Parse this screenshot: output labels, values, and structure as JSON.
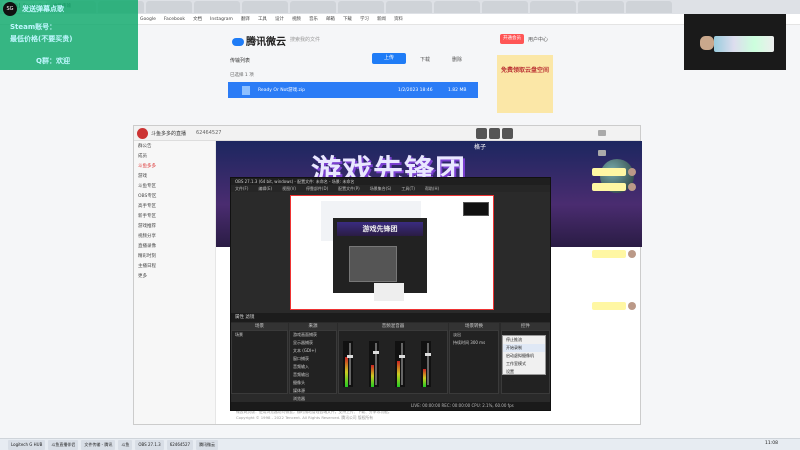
{
  "browser": {
    "tabs": [
      "【斗鱼】Ready Or Not",
      "文件传输",
      "",
      "",
      "",
      "",
      "",
      "",
      "",
      "",
      "",
      "",
      "",
      ""
    ],
    "bookmarks": [
      "Google",
      "Facebook",
      "文档",
      "Instagram",
      "翻译",
      "工具",
      "设计",
      "视频",
      "音乐",
      "邮箱",
      "下载",
      "学习",
      "新闻",
      "资料"
    ]
  },
  "overlay": {
    "logo": "SG",
    "line1": "发送弹幕点歌",
    "line2": "Steam账号：",
    "line3": "最低价格(不要买贵)",
    "line4": "Q群：欢迎"
  },
  "weiyun": {
    "logo": "腾讯微云",
    "search": "搜索我的文件",
    "member": "开通会员",
    "user": "用户中心",
    "task_title": "传输列表",
    "upload_btn": "上传",
    "download_btn": "下载",
    "delete_btn": "删除",
    "select_all": "已选择 1 项",
    "file_name": "Ready Or Not游戏.zip",
    "file_time": "1/2/2023 18:46",
    "file_size": "1.82 MB",
    "ad_text": "免费领取云盘空间"
  },
  "qq": {
    "title": "斗鱼多多的直播",
    "ratio": "62464527",
    "banner_label": "格子",
    "banner_title": "游戏先锋团",
    "side_items": [
      "群公告",
      "成员",
      "斗鱼多多",
      "游戏",
      "斗鱼专区",
      "OBS专区",
      "高手专区",
      "新手专区",
      "游戏推荐",
      "视频分享",
      "直播录像",
      "精彩时刻",
      "主播日程",
      "更多"
    ]
  },
  "obs": {
    "title": "OBS 27.1.3 (64 bit, windows) - 配置文件: 未命名 - 场景: 未命名",
    "menu": [
      "文件(F)",
      "编辑(E)",
      "视图(V)",
      "停靠部件(D)",
      "配置文件(P)",
      "场景集合(S)",
      "工具(T)",
      "帮助(H)"
    ],
    "preview_banner": "游戏先锋团",
    "ctl_bar": "属性  滤镜",
    "panels": [
      "场景",
      "来源",
      "音频混音器",
      "场景转换",
      "控件"
    ],
    "scene_row": "场景",
    "sources": [
      "游戏画面捕获",
      "显示器捕获",
      "文本 (GDI+)",
      "窗口捕获",
      "音频输入",
      "音频输出",
      "摄像头",
      "媒体源",
      "浏览器",
      "图片"
    ],
    "transition_rows": [
      "淡出",
      "持续时间  300 ms"
    ],
    "context_menu": [
      "停止推流",
      "开始录制",
      "启动虚拟摄像机",
      "工作室模式",
      "设置",
      "退出"
    ],
    "status": "LIVE: 00:00:00  REC: 00:00:00  CPU: 2.1%, 60.00 fps"
  },
  "footer": {
    "line1": "微云网页版：使用浏览器访问微云，随时随地管理云端文件。支持上传、下载、分享等功能。",
    "line2": "Copyright © 1998 - 2022 Tencent. All Rights Reserved. 腾讯公司 版权所有"
  },
  "taskbar": {
    "items": [
      "Logitech G HUB",
      "斗鱼直播伴侣",
      "文件传输 - 腾讯",
      "斗鱼",
      "OBS 27.1.3",
      "62464527",
      "腾讯微云"
    ],
    "clock": "11:08"
  }
}
